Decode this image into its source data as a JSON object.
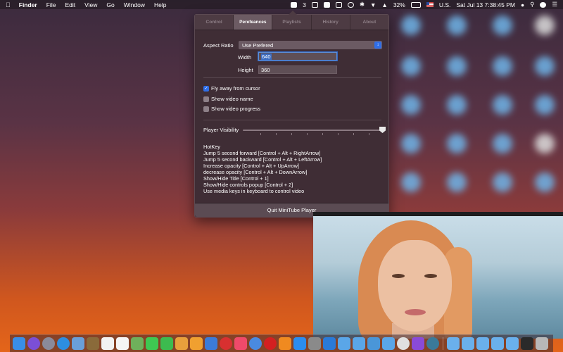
{
  "menubar": {
    "app": "Finder",
    "items": [
      "File",
      "Edit",
      "View",
      "Go",
      "Window",
      "Help"
    ],
    "badge_count": "3",
    "battery": "32%",
    "input_source": "U.S.",
    "datetime": "Sat Jul 13  7:38:45 PM"
  },
  "panel": {
    "tabs": [
      "Control",
      "Perefeances",
      "Playlists",
      "History",
      "About"
    ],
    "active_tab": "Perefeances",
    "aspect_ratio": {
      "label": "Aspect Ratio",
      "value": "Use Prefered"
    },
    "width": {
      "label": "Width",
      "value": "640"
    },
    "height": {
      "label": "Height",
      "value": "360"
    },
    "checkboxes": [
      {
        "label": "Fly away from cursor",
        "checked": true
      },
      {
        "label": "Show video name",
        "checked": false
      },
      {
        "label": "Show video progress",
        "checked": false
      }
    ],
    "player_visibility": {
      "label": "Player Visibility",
      "value": 1.0
    },
    "hotkeys": [
      "HotKey",
      "Jump 5 second forward [Control + Alt + RightArrow]",
      "Jump 5 second backward [Control + Alt + LeftArrow]",
      "Increase opacity [Control + Alt + UpArrow]",
      "decrease opacity [Control + Alt + DownArrow]",
      "Show/Hide Title [Control + 1]",
      "Show/Hide controls popup [Control + 2]",
      "Use media keys in keyboard to control video"
    ],
    "quit_label": "Quit MiniTube Player"
  },
  "colors": {
    "accent": "#2f6ee7",
    "panel_bg": "#3f2d35",
    "active_tab": "#6c5b63"
  },
  "dock": {
    "icons": [
      {
        "name": "finder-icon",
        "color": "#3a8ee6"
      },
      {
        "name": "siri-icon",
        "color": "#7b4fd6"
      },
      {
        "name": "launchpad-icon",
        "color": "#8a8a9a"
      },
      {
        "name": "safari-icon",
        "color": "#2d8ee0"
      },
      {
        "name": "preview-icon",
        "color": "#6a9fd8"
      },
      {
        "name": "notes-icon",
        "color": "#8a6a3a"
      },
      {
        "name": "calendar-icon",
        "color": "#f2f2f2"
      },
      {
        "name": "reminders-icon",
        "color": "#f5f5f5"
      },
      {
        "name": "maps-icon",
        "color": "#6fb05b"
      },
      {
        "name": "messages-icon",
        "color": "#3fc852"
      },
      {
        "name": "facetime-icon",
        "color": "#3dbb4f"
      },
      {
        "name": "photos-icon",
        "color": "#e8a03c"
      },
      {
        "name": "pages-icon",
        "color": "#f0a030"
      },
      {
        "name": "keynote-icon",
        "color": "#3b7bd8"
      },
      {
        "name": "no-entry-icon",
        "color": "#d83030"
      },
      {
        "name": "music-icon",
        "color": "#f04a6a"
      },
      {
        "name": "chrome-icon",
        "color": "#4a8ae0"
      },
      {
        "name": "opera-icon",
        "color": "#d42020"
      },
      {
        "name": "books-icon",
        "color": "#f08a20"
      },
      {
        "name": "app-store-icon",
        "color": "#2b8df0"
      },
      {
        "name": "system-preferences-icon",
        "color": "#8a8a8a"
      },
      {
        "name": "xcode-icon",
        "color": "#2a7ad8"
      },
      {
        "name": "folder-icon",
        "color": "#5aa6e8"
      },
      {
        "name": "folder-icon",
        "color": "#5aa6e8"
      },
      {
        "name": "folder-icon",
        "color": "#4a96d8"
      },
      {
        "name": "folder-icon",
        "color": "#5aa6e8"
      },
      {
        "name": "itunes-icon",
        "color": "#e0e0e0"
      },
      {
        "name": "imovie-icon",
        "color": "#8a4ad8"
      },
      {
        "name": "minitube-icon",
        "color": "#3a7a9a"
      },
      {
        "name": "folder-icon",
        "color": "#6ab0ec"
      },
      {
        "name": "folder-icon",
        "color": "#6ab0ec"
      },
      {
        "name": "folder-icon",
        "color": "#6ab0ec"
      },
      {
        "name": "folder-icon",
        "color": "#6ab0ec"
      },
      {
        "name": "folder-icon",
        "color": "#6ab0ec"
      },
      {
        "name": "terminal-icon",
        "color": "#2a2a2a"
      },
      {
        "name": "trash-icon",
        "color": "#b8b8b8"
      }
    ]
  }
}
